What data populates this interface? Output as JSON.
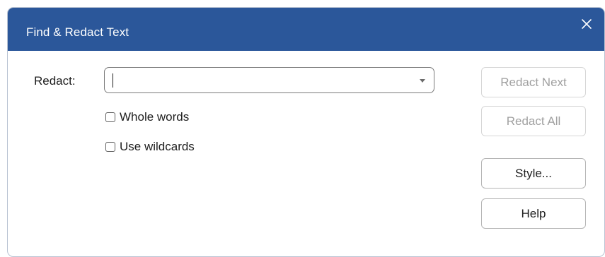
{
  "dialog": {
    "title": "Find & Redact Text",
    "close_icon": "close-icon",
    "redact": {
      "label": "Redact:",
      "value": "",
      "placeholder": "",
      "dropdown_icon": "dropdown-arrow-icon"
    },
    "options": {
      "whole_words": {
        "label": "Whole words",
        "checked": false
      },
      "use_wildcards": {
        "label": "Use wildcards",
        "checked": false
      }
    },
    "buttons": {
      "redact_next": {
        "label": "Redact Next",
        "enabled": false
      },
      "redact_all": {
        "label": "Redact All",
        "enabled": false
      },
      "style": {
        "label": "Style...",
        "enabled": true
      },
      "help": {
        "label": "Help",
        "enabled": true
      }
    },
    "colors": {
      "titlebar": "#2b579a",
      "title_text": "#ffffff",
      "disabled_text": "#a0a0a0"
    }
  }
}
